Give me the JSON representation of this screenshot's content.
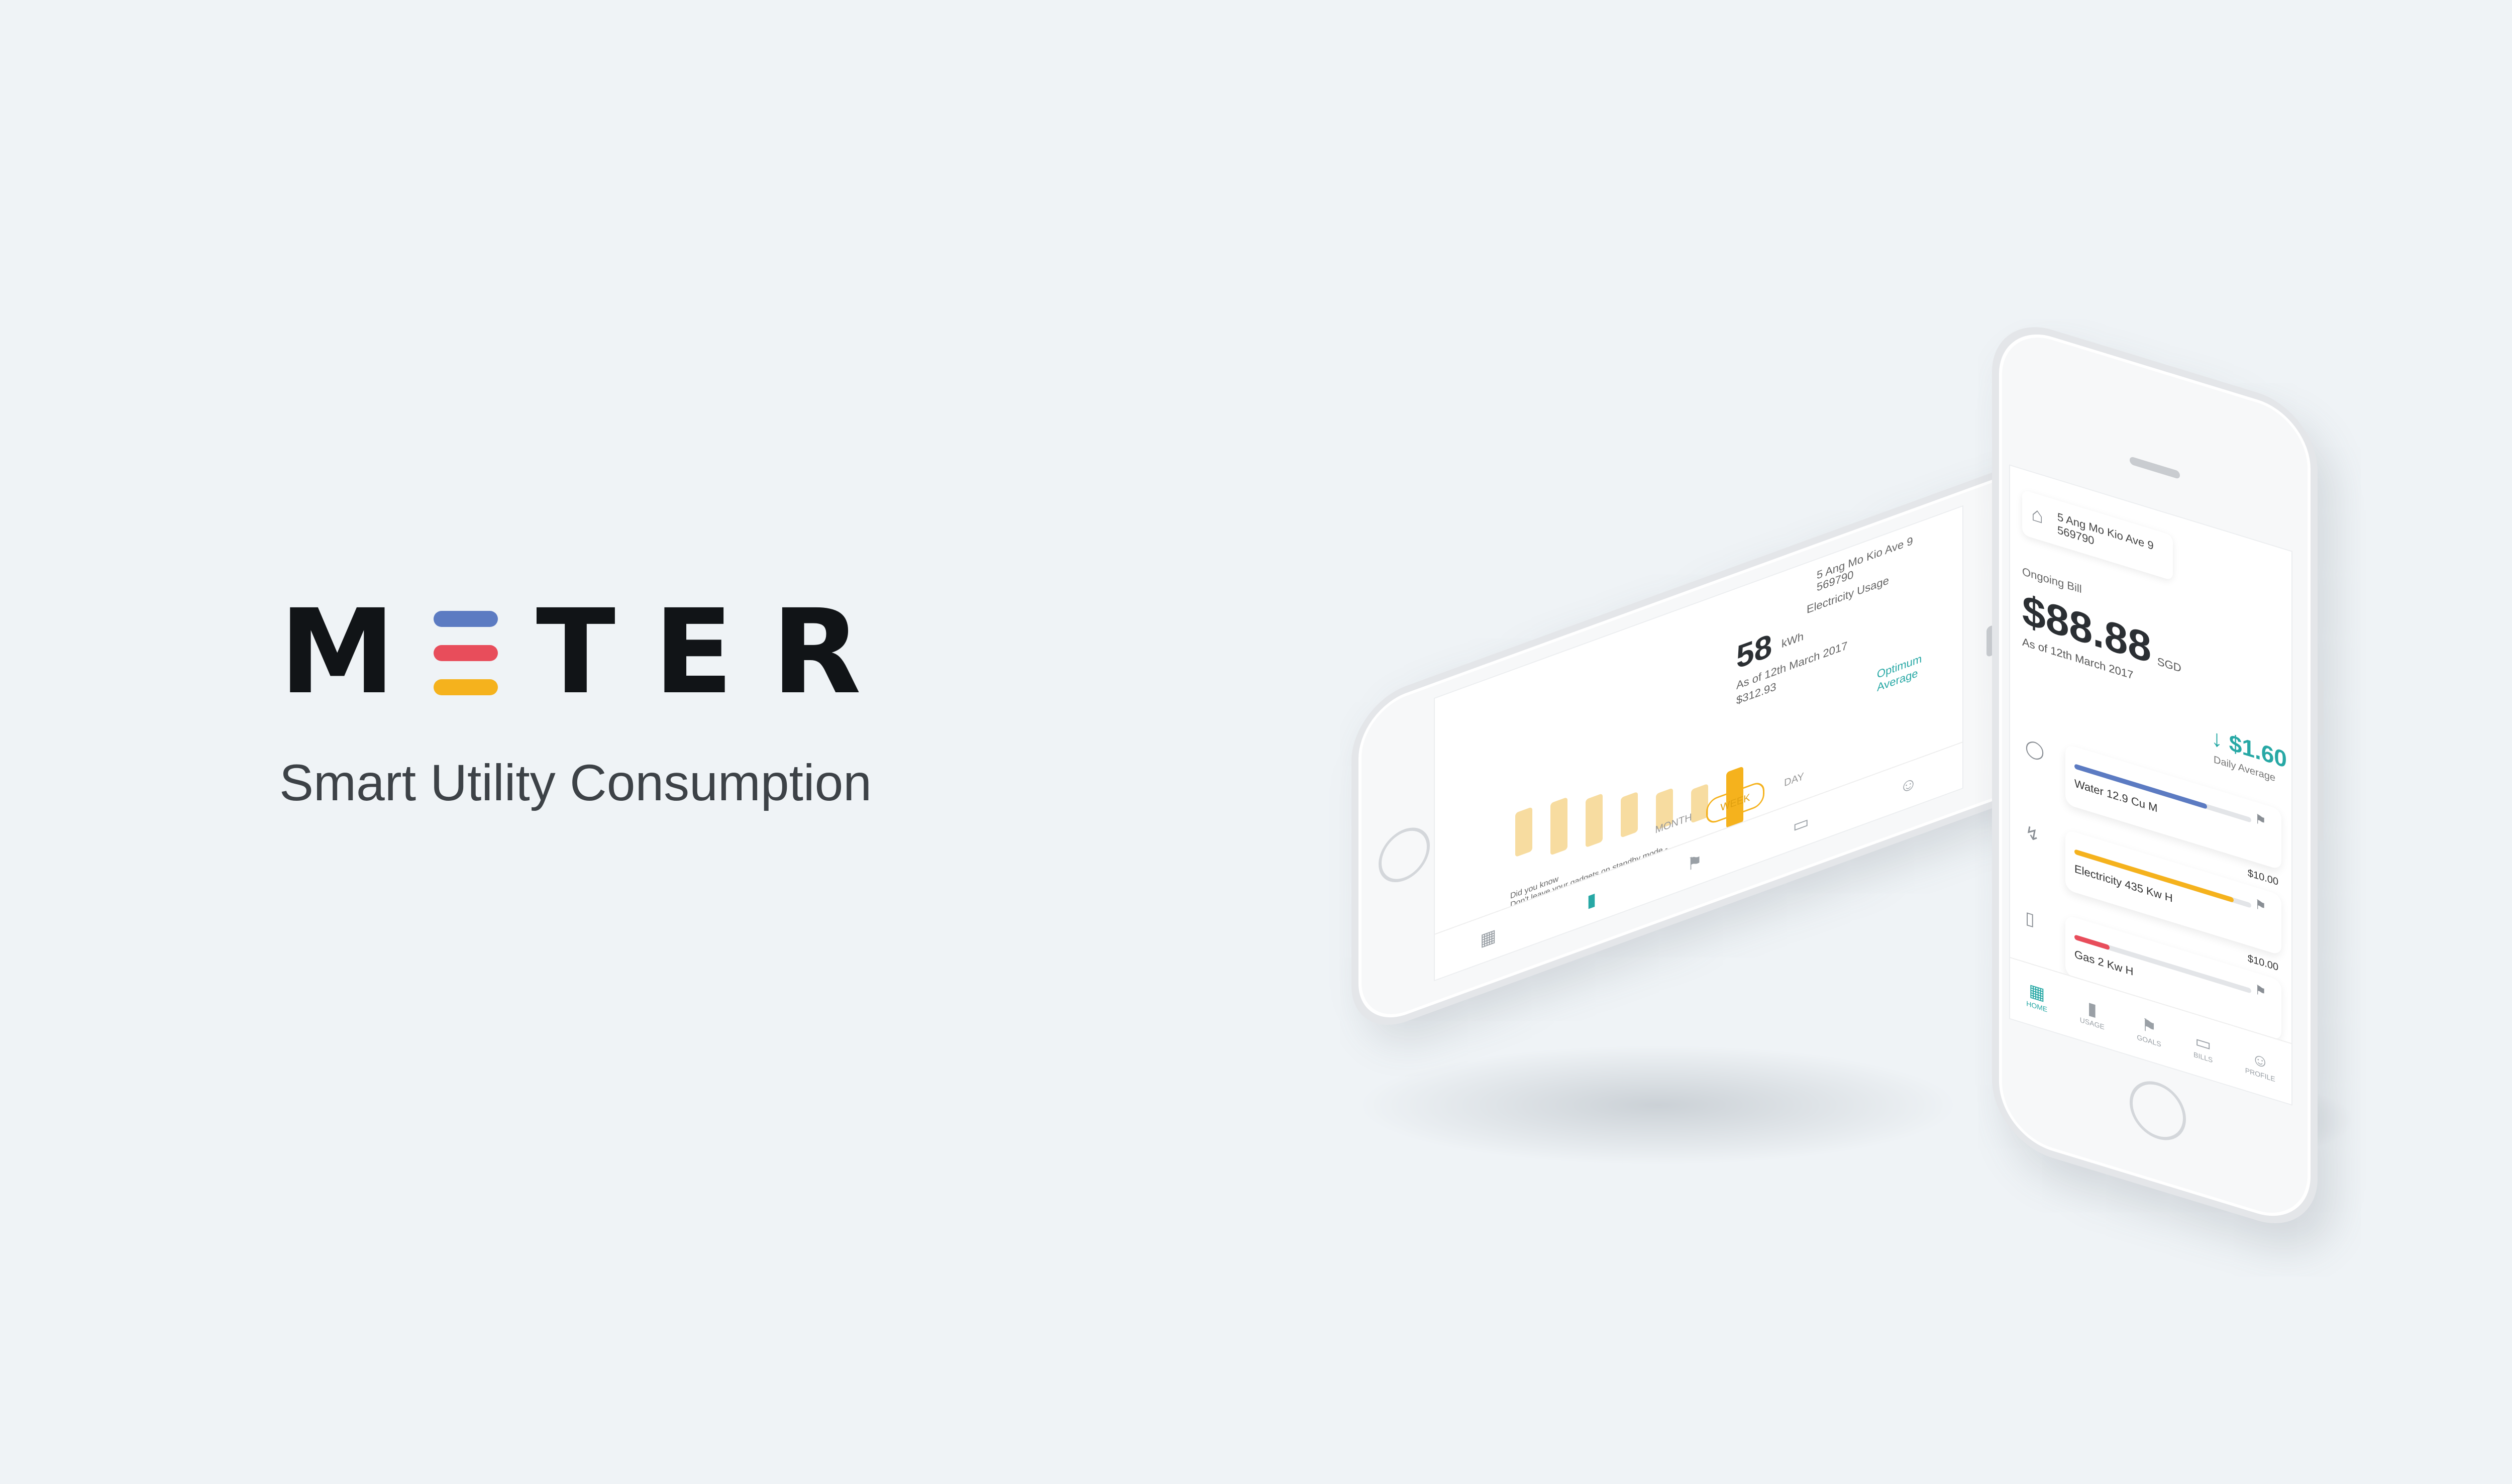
{
  "brand": {
    "logo_letters": [
      "M",
      "T",
      "E",
      "R"
    ],
    "logo_bar_colors": [
      "#5c7bc2",
      "#e84d5b",
      "#f5b21d"
    ],
    "tagline": "Smart Utility Consumption"
  },
  "front_screen": {
    "address_line1": "5 Ang Mo Kio Ave 9",
    "address_line2": "569790",
    "ongoing_label": "Ongoing Bill",
    "amount": "$88.88",
    "currency": "SGD",
    "as_of": "As of 12th March 2017",
    "delta": "↓ $1.60",
    "delta_label": "Daily Average",
    "utilities": [
      {
        "name": "Water",
        "usage": "12.9 Cu M",
        "amount": "$10.00",
        "color": "#5c7bc2",
        "fill": 0.75,
        "icon": "water-drop-icon"
      },
      {
        "name": "Electricity",
        "usage": "435 Kw H",
        "amount": "$10.00",
        "color": "#f5b21d",
        "fill": 0.9,
        "icon": "lightning-icon"
      },
      {
        "name": "Gas",
        "usage": "2 Kw H",
        "amount": "$10.00",
        "color": "#e84d5b",
        "fill": 0.2,
        "icon": "gas-cylinder-icon"
      }
    ],
    "tabs": [
      {
        "label": "HOME",
        "icon": "home-grid-icon",
        "active": true
      },
      {
        "label": "USAGE",
        "icon": "bar-chart-icon",
        "active": false
      },
      {
        "label": "GOALS",
        "icon": "flag-icon",
        "active": false
      },
      {
        "label": "BILLS",
        "icon": "wallet-icon",
        "active": false
      },
      {
        "label": "PROFILE",
        "icon": "user-icon",
        "active": false
      }
    ]
  },
  "back_screen": {
    "address_line1": "5 Ang Mo Kio Ave 9",
    "address_line2": "569790",
    "title": "Electricity Usage",
    "value": "58",
    "unit": "kWh",
    "as_of": "As of 12th March 2017",
    "cost": "$312.93",
    "legend": "Optimum Average",
    "segments": [
      "MONTH",
      "WEEK",
      "DAY"
    ],
    "active_segment": "WEEK",
    "tip": "Did you know\nDon't leave your gadgets on standby mode - turn them off at the power switch.",
    "bar_color": "#f5b21d",
    "bar_values": [
      0.55,
      0.65,
      0.6,
      0.5,
      0.45,
      0.42,
      0.7
    ]
  }
}
